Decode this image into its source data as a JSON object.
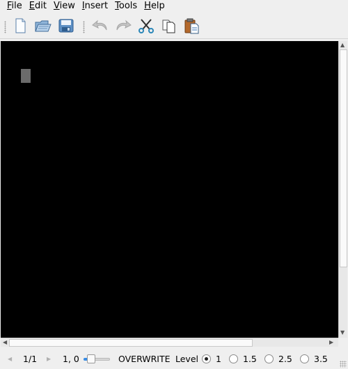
{
  "menubar": {
    "items": [
      {
        "mnemonic": "F",
        "rest": "ile"
      },
      {
        "mnemonic": "E",
        "rest": "dit"
      },
      {
        "mnemonic": "V",
        "rest": "iew"
      },
      {
        "mnemonic": "I",
        "rest": "nsert"
      },
      {
        "mnemonic": "T",
        "rest": "ools"
      },
      {
        "mnemonic": "H",
        "rest": "elp"
      }
    ]
  },
  "toolbar": {
    "buttons": [
      "new-document-icon",
      "open-folder-icon",
      "save-disk-icon",
      "undo-icon",
      "redo-icon",
      "cut-scissors-icon",
      "copy-icon",
      "paste-icon"
    ],
    "disabled": [
      "undo-icon",
      "redo-icon"
    ]
  },
  "editor": {
    "background": "#000000",
    "cursor_color": "#6b6b6b"
  },
  "statusbar": {
    "page": "1/1",
    "position": "1, 0",
    "zoom_fraction": 0.2,
    "mode": "OVERWRITE",
    "level_label": "Level",
    "levels": [
      "1",
      "1.5",
      "2.5",
      "3.5"
    ],
    "selected_level": "1"
  },
  "colors": {
    "accent": "#3a8ee6",
    "chrome": "#efefef"
  }
}
